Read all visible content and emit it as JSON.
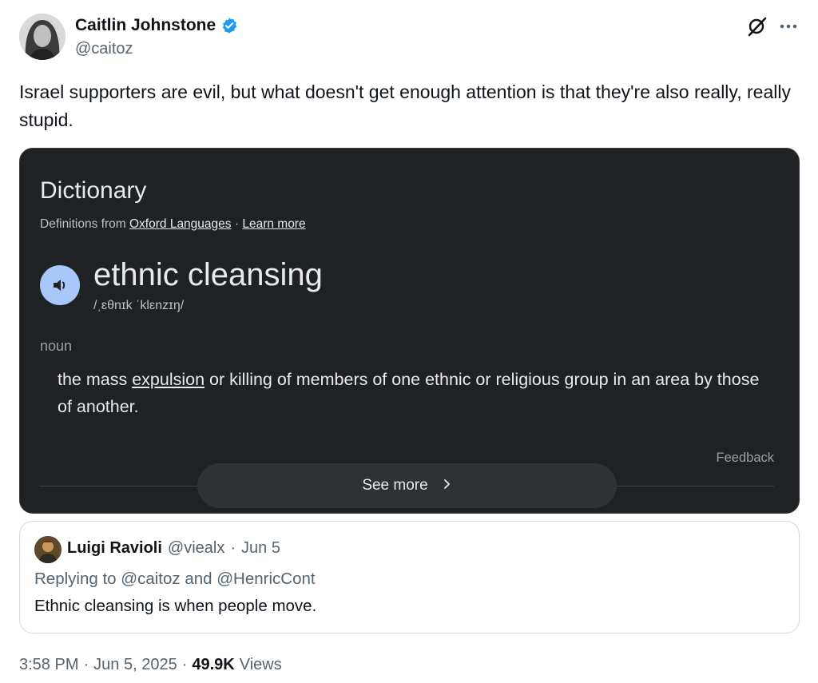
{
  "author": {
    "display_name": "Caitlin Johnstone",
    "handle": "@caitoz"
  },
  "tweet": {
    "text": "Israel supporters are evil, but what doesn't get enough attention is that they're also really, really stupid."
  },
  "media": {
    "title": "Dictionary",
    "subtitle_prefix": "Definitions from",
    "source_link": "Oxford Languages",
    "separator": " · ",
    "learn_more": "Learn more",
    "term": "ethnic cleansing",
    "phonetic": "/ˌɛθnɪk ˈklɛnzɪŋ/",
    "part_of_speech": "noun",
    "definition_before": "the mass ",
    "definition_link": "expulsion",
    "definition_after": " or killing of members of one ethnic or religious group in an area by those of another.",
    "feedback": "Feedback",
    "see_more": "See more"
  },
  "quote": {
    "name": "Luigi Ravioli",
    "handle": "@viealx",
    "sep": "·",
    "date": "Jun 5",
    "replying_to": "Replying to @caitoz and @HenricCont",
    "text": "Ethnic cleansing is when people move."
  },
  "footer": {
    "time": "3:58 PM",
    "sep1": "·",
    "date": "Jun 5, 2025",
    "sep2": "·",
    "views_count": "49.9K",
    "views_label": "Views"
  },
  "colors": {
    "verified": "#1d9bf0",
    "card_bg": "#202124",
    "speaker_bg": "#a8c7fa"
  }
}
